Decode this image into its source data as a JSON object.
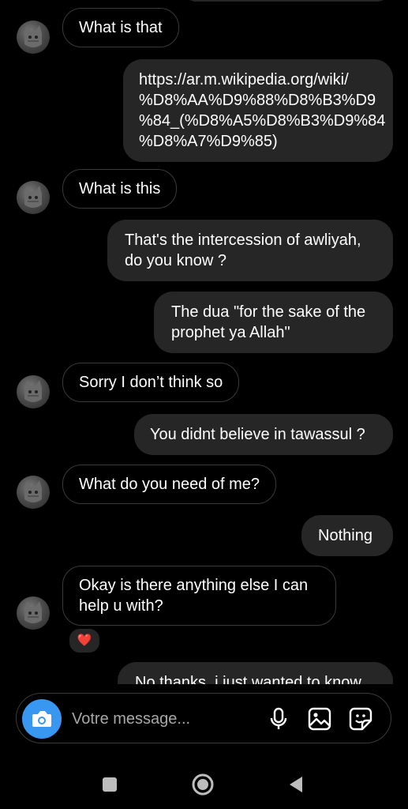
{
  "thread": {
    "messages": [
      {
        "side": "in",
        "text": "What is that"
      },
      {
        "side": "out",
        "text": "https://ar.m.wikipedia.org/wiki/\n%D8%AA%D9%88%D8%B3%D9\n%84_(%D8%A5%D8%B3%D9%84\n%D8%A7%D9%85)"
      },
      {
        "side": "in",
        "text": "What is this"
      },
      {
        "side": "out",
        "text": "That's the intercession of awliyah,\ndo you know ?"
      },
      {
        "side": "out",
        "text": "The dua \"for the sake of the\nprophet ya Allah\""
      },
      {
        "side": "in",
        "text": "Sorry I don’t think so"
      },
      {
        "side": "out",
        "text": "You didnt believe in tawassul ?"
      },
      {
        "side": "in",
        "text": "What do you need of me?"
      },
      {
        "side": "out",
        "text": "Nothing"
      },
      {
        "side": "in",
        "text": "Okay is there anything else I can\nhelp u with?",
        "reaction": "❤️"
      },
      {
        "side": "out",
        "text": "No thanks, i just wanted to know"
      }
    ]
  },
  "composer": {
    "placeholder": "Votre message...",
    "icons": [
      "camera-icon",
      "microphone-icon",
      "gallery-icon",
      "sticker-icon"
    ],
    "accent": "#3897f0"
  },
  "navbar": {
    "buttons": [
      "recents-button",
      "home-button",
      "back-button"
    ]
  }
}
